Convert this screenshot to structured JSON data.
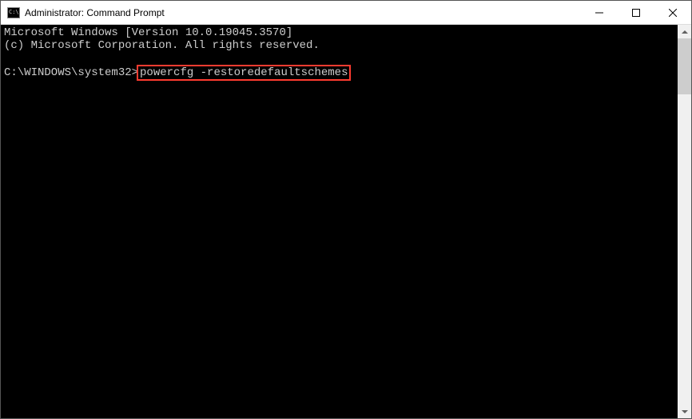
{
  "titlebar": {
    "icon_text": "C:\\",
    "title": "Administrator: Command Prompt"
  },
  "terminal": {
    "line1": "Microsoft Windows [Version 10.0.19045.3570]",
    "line2": "(c) Microsoft Corporation. All rights reserved.",
    "blank": "",
    "prompt": "C:\\WINDOWS\\system32>",
    "command": "powercfg -restoredefaultschemes"
  }
}
